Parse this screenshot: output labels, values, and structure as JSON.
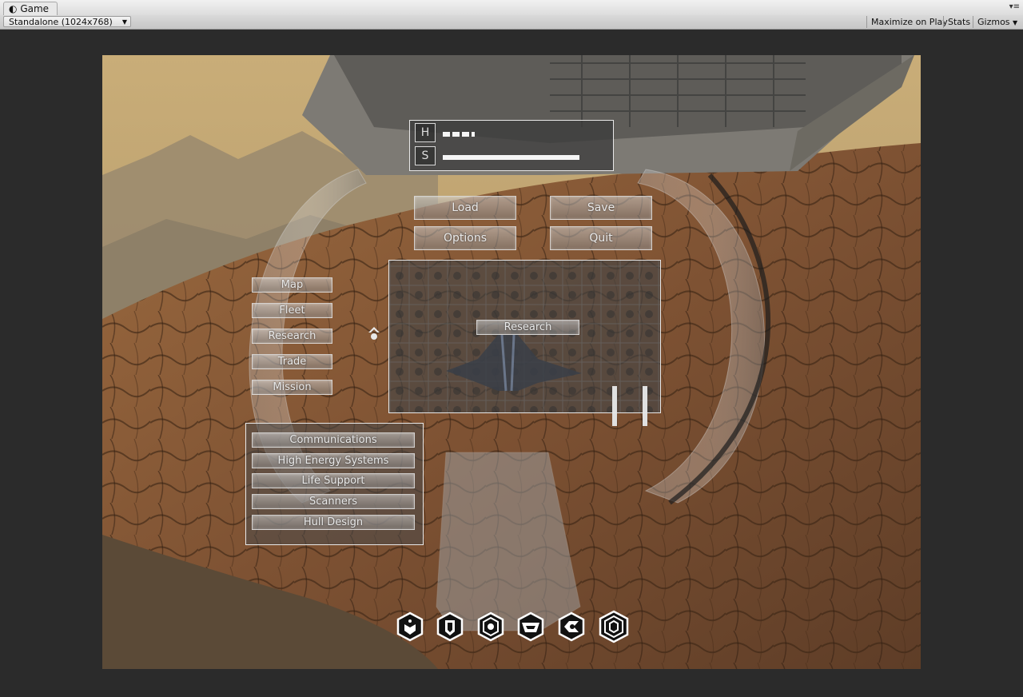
{
  "editor": {
    "tab_title": "Game",
    "resolution": "Standalone (1024x768)",
    "toolbar": [
      "Maximize on Play",
      "Stats",
      "Gizmos"
    ]
  },
  "hud": {
    "status": [
      {
        "label": "H",
        "value": 0.17
      },
      {
        "label": "S",
        "value": 0.73
      }
    ],
    "menu_buttons": [
      "Load",
      "Save",
      "Options",
      "Quit"
    ],
    "side_menu": [
      "Map",
      "Fleet",
      "Research",
      "Trade",
      "Mission"
    ],
    "research_panel_button": "Research",
    "systems": [
      "Communications",
      "High Energy Systems",
      "Life Support",
      "Scanners",
      "Hull Design"
    ],
    "hex_icons": [
      "drop-shield-icon",
      "badge-icon",
      "gear-hex-icon",
      "hull-icon",
      "reactor-icon",
      "concentric-hex-icon"
    ]
  },
  "colors": {
    "ui_border": "#e8e8e8",
    "button_text": "#e9e9e9"
  }
}
